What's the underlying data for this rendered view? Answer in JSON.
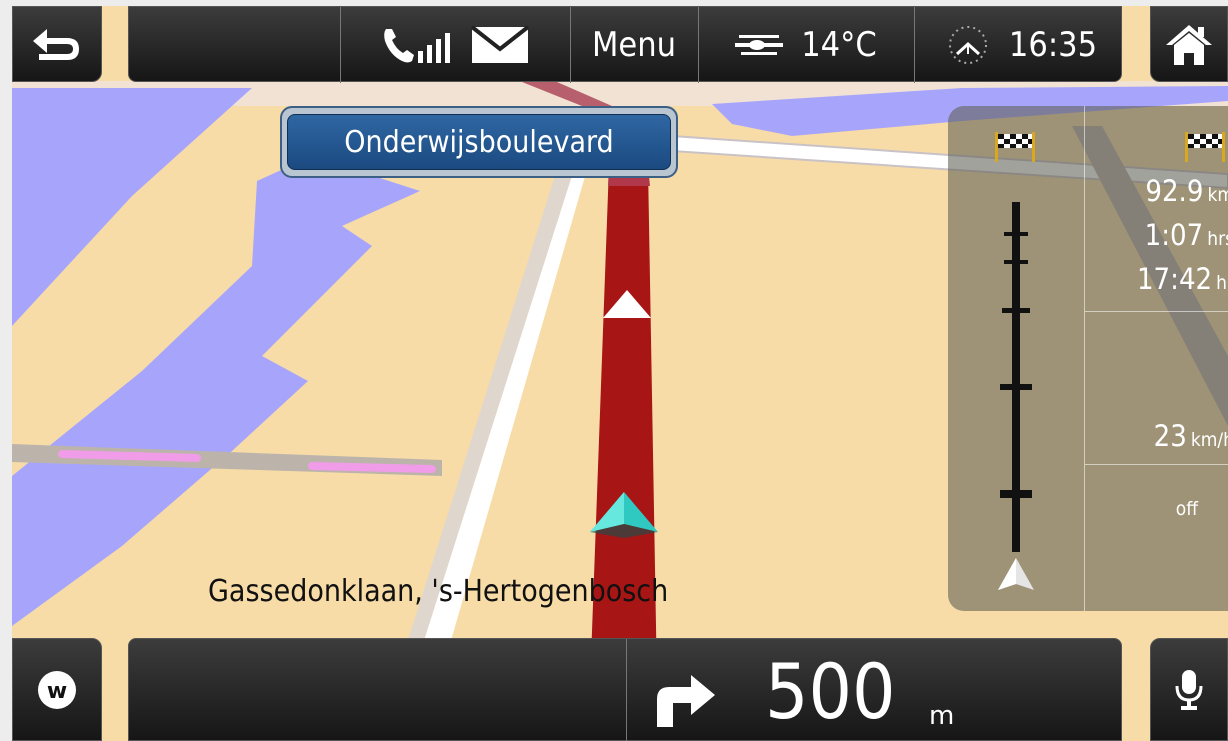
{
  "status_bar": {
    "menu_label": "Menu",
    "temperature": "14°C",
    "time": "16:35",
    "icons": [
      "back-arrow-icon",
      "phone-signal-icon",
      "envelope-icon",
      "fog-weather-icon",
      "sun-clock-icon",
      "home-icon"
    ]
  },
  "street_sign": "Onderwijsboulevard",
  "route_panel": {
    "distance_value": "92.9",
    "distance_unit": "km",
    "duration_value": "1:07",
    "duration_unit": "hrs",
    "arrival_value": "17:42",
    "arrival_unit": "hr",
    "speed_value": "23",
    "speed_unit": "km/h",
    "speed_limit_status": "off",
    "icons": [
      "checkered-flag-icon",
      "checkered-flag-icon",
      "route-progress-icon"
    ]
  },
  "current_location": "Gassedonklaan, 's-Hertogenbosch",
  "bottom_bar": {
    "next_turn_distance": "500",
    "next_turn_unit": "m",
    "icons": [
      "waze-w-icon",
      "turn-right-arrow-icon",
      "microphone-icon"
    ]
  },
  "colors": {
    "map_land": "#f8dca7",
    "water": "#a7a5fb",
    "route": "#a81515",
    "bar_background": "#1f1f1f",
    "street_sign_blue": "#245891"
  }
}
